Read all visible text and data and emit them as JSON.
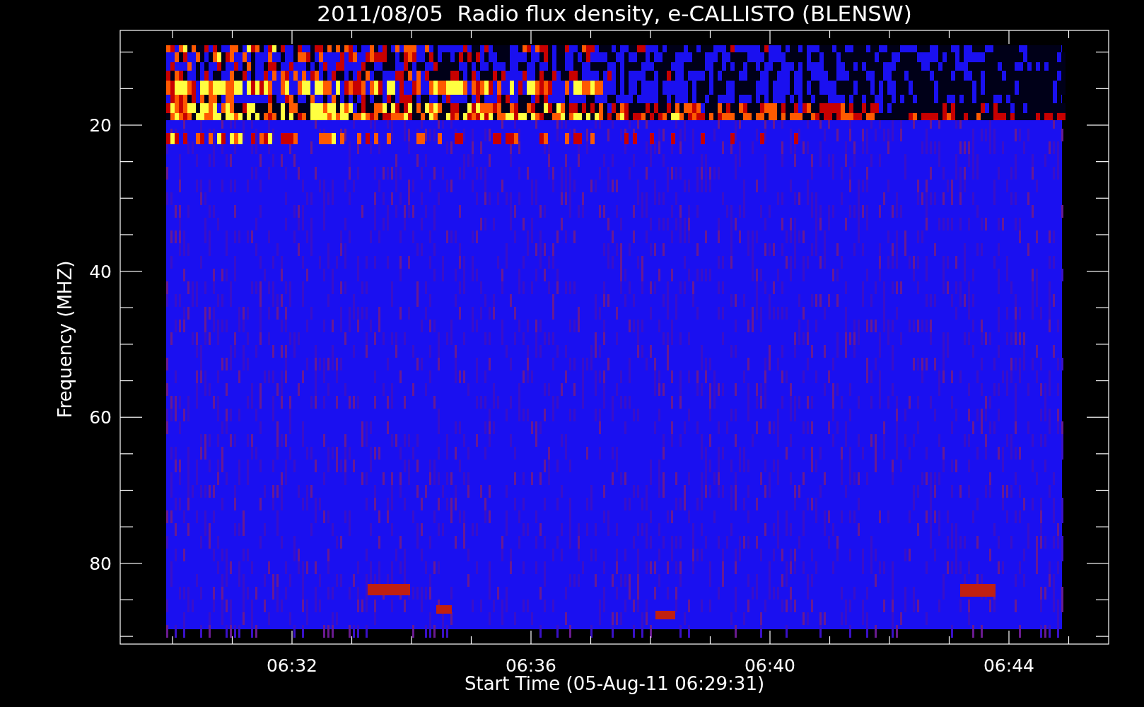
{
  "plot": {
    "title": "2011/08/05  Radio flux density, e-CALLISTO (BLENSW)",
    "x_axis": {
      "label": "Start Time (05-Aug-11 06:29:31)",
      "ticks": [
        "06:32",
        "06:36",
        "06:40",
        "06:44"
      ]
    },
    "y_axis": {
      "label": "Frequency (MHZ)",
      "ticks": [
        "20",
        "40",
        "60",
        "80"
      ]
    }
  }
}
